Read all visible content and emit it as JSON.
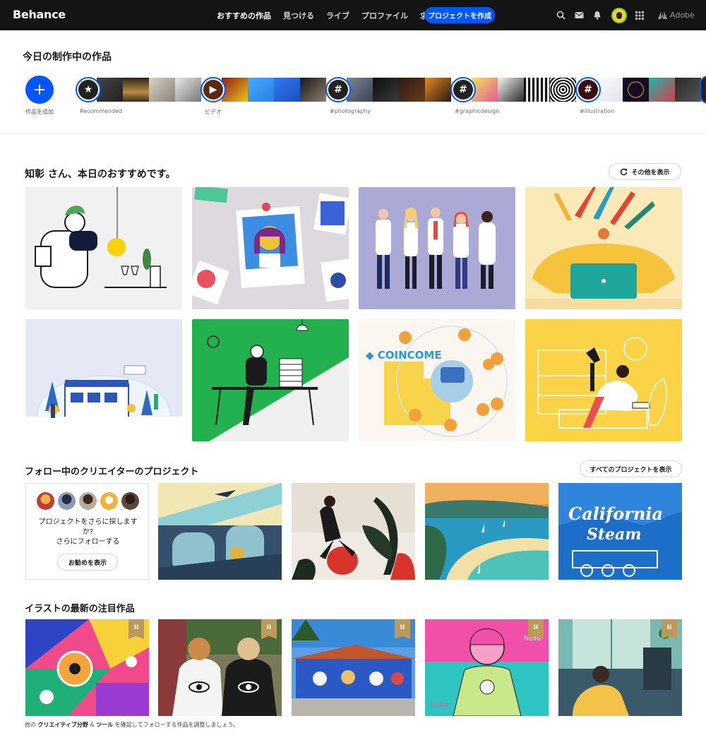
{
  "nav": {
    "logo": "Behance",
    "links": [
      "おすすめの作品",
      "見つける",
      "ライブ",
      "プロファイル",
      "求人"
    ],
    "cta": "プロジェクトを作成",
    "icons": [
      "search-icon",
      "mail-icon",
      "bell-icon",
      "avatar",
      "apps-grid-icon"
    ],
    "adobe": "Adobe"
  },
  "progress": {
    "title": "今日の制作中の作品",
    "add_label": "作品を追加",
    "stories": [
      {
        "label": "Recommended",
        "symbol": "★",
        "thumbs": [
          "#3a3a3a",
          "#6e5a3a",
          "#c9c2b4",
          "#8a8a8a"
        ]
      },
      {
        "label": "ビデオ",
        "symbol": "▶",
        "thumbs": [
          "#7a1e12",
          "#3aa0ff",
          "#1f5fd6",
          "#2e2b27"
        ]
      },
      {
        "label": "#photography",
        "symbol": "#",
        "thumbs": [
          "#5d6675",
          "#1c1c1c",
          "#4b2b1e",
          "#c46d1c"
        ]
      },
      {
        "label": "#graphicdesign",
        "symbol": "#",
        "thumbs": [
          "#e6d64b",
          "#2a2a2a",
          "#111111",
          "#9a9a9a"
        ]
      },
      {
        "label": "#illustration",
        "symbol": "#",
        "thumbs": [
          "#f5f5f5",
          "#120d22",
          "#1fb5a8",
          "#e0394a"
        ]
      }
    ]
  },
  "recommend": {
    "title": "知彰 さん、本日のおすすめです。",
    "more_button": "その他を表示"
  },
  "following": {
    "title": "フォロー中のクリエイターのプロジェクト",
    "all_button": "すべてのプロジェクトを表示",
    "box_line1": "プロジェクトをさらに探します",
    "box_line2": "か?",
    "box_line3": "さらにフォローする",
    "box_button": "お勧めを表示"
  },
  "illustration": {
    "title": "イラストの最新の注目作品",
    "badge": "II"
  },
  "footnote": {
    "pre": "他の",
    "link1": "クリエイティブ分野",
    "amp": "&",
    "link2": "ツール",
    "post": "を確認してフォローする作品を調整しましょう。"
  }
}
